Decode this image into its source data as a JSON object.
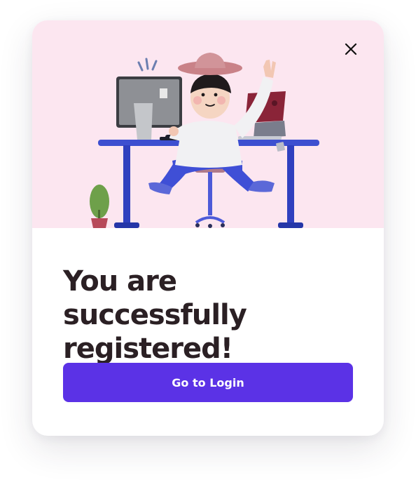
{
  "modal": {
    "title": "You are successfully registered!",
    "button_label": "Go to Login",
    "hero_background": "#fce6f0",
    "accent_color": "#5b32e6",
    "close_icon": "close-icon"
  }
}
